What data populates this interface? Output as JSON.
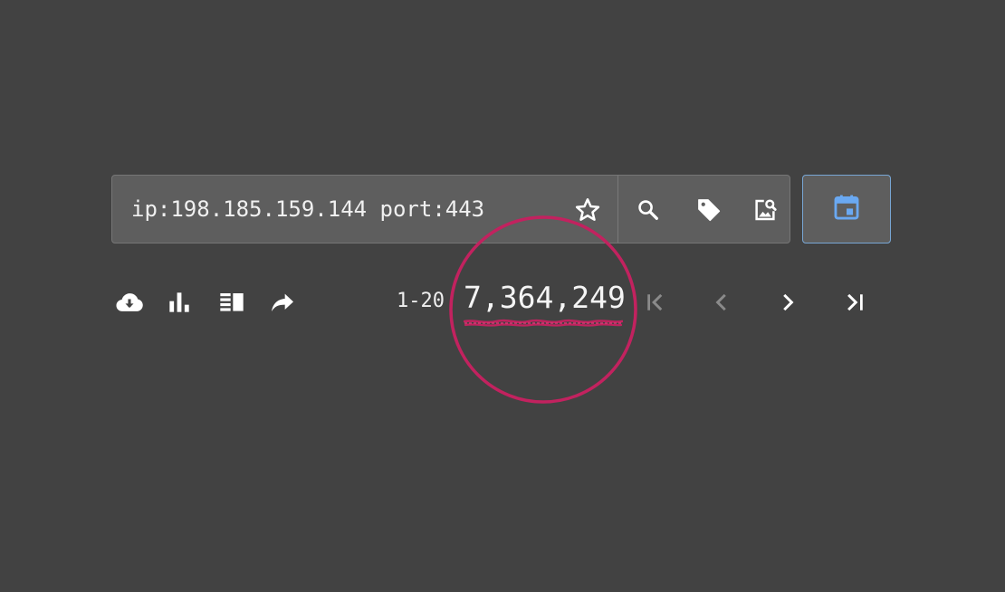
{
  "search": {
    "query": "ip:198.185.159.144 port:443"
  },
  "icons": {
    "favorite": "star-outline-icon",
    "search": "magnifier-icon",
    "tag": "tag-icon",
    "image_search": "image-search-icon",
    "calendar": "calendar-icon",
    "download": "cloud-download-icon",
    "facet": "bar-chart-icon",
    "view": "view-list-icon",
    "share": "share-arrow-icon",
    "first": "first-page-icon",
    "prev": "chevron-left-icon",
    "next": "chevron-right-icon",
    "last": "last-page-icon"
  },
  "results": {
    "range": "1-20",
    "total": "7,364,249"
  },
  "colors": {
    "background": "#424242",
    "search_bar": "#5e5e5e",
    "calendar_accent": "#6aa9f2",
    "highlight": "#c2225f",
    "icon_active": "#ffffff",
    "icon_disabled": "#8a8a8a"
  }
}
